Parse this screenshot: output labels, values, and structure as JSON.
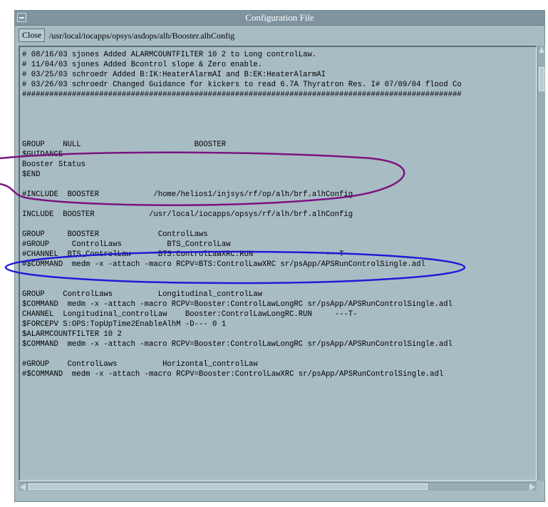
{
  "window": {
    "title": "Configuration File"
  },
  "toolbar": {
    "close_label": "Close",
    "file_path": "/usr/local/iocapps/opsys/asdops/alh/Booster.alhConfig"
  },
  "config_text": {
    "lines": [
      "# 08/16/03 sjones Added ALARMCOUNTFILTER 10 2 to Long controlLaw.",
      "# 11/04/03 sjones Added Bcontrol slope & Zero enable.",
      "# 03/25/03 schroedr Added B:IK:HeaterAlarmAI and B:EK:HeaterAlarmAI",
      "# 03/26/03 schroedr Changed Guidance for kickers to read 6.7A Thyratron Res. I# 07/09/04 flood Co",
      "#################################################################################################",
      "",
      "",
      "",
      "",
      "GROUP    NULL                         BOOSTER",
      "$GUIDANCE",
      "Booster Status",
      "$END",
      "",
      "#INCLUDE  BOOSTER            /home/helios1/injsys/rf/op/alh/brf.alhConfig",
      "",
      "INCLUDE  BOOSTER            /usr/local/iocapps/opsys/rf/alh/brf.alhConfig",
      "",
      "GROUP     BOOSTER             ControlLaws",
      "#GROUP     ControlLaws          BTS_ControlLaw",
      "#CHANNEL  BTS_ControlLaw      BTS:ControlLawXRC.RUN                ---T-",
      "#$COMMAND  medm -x -attach -macro RCPV=BTS:ControlLawXRC sr/psApp/APSRunControlSingle.adl",
      "",
      "",
      "GROUP    ControlLaws          Longitudinal_controlLaw",
      "$COMMAND  medm -x -attach -macro RCPV=Booster:ControlLawLongRC sr/psApp/APSRunControlSingle.adl",
      "CHANNEL  Longitudinal_controlLaw    Booster:ControlLawLongRC.RUN     ---T-",
      "$FORCEPV S:OPS:TopUpTime2EnableAlhM -D--- 0 1",
      "$ALARMCOUNTFILTER 10 2",
      "$COMMAND  medm -x -attach -macro RCPV=Booster:ControlLawLongRC sr/psApp/APSRunControlSingle.adl",
      "",
      "#GROUP    ControlLaws          Horizontal_controlLaw",
      "#$COMMAND  medm -x -attach -macro RCPV=Booster:ControlLawXRC sr/psApp/APSRunControlSingle.adl"
    ]
  },
  "annotations": {
    "group_null_ellipse_color": "#7b1480",
    "include_booster_ellipse_color": "#1f1ad6"
  },
  "colors": {
    "window_bg": "#a8bcc4",
    "titlebar_bg": "#7f93a0"
  }
}
